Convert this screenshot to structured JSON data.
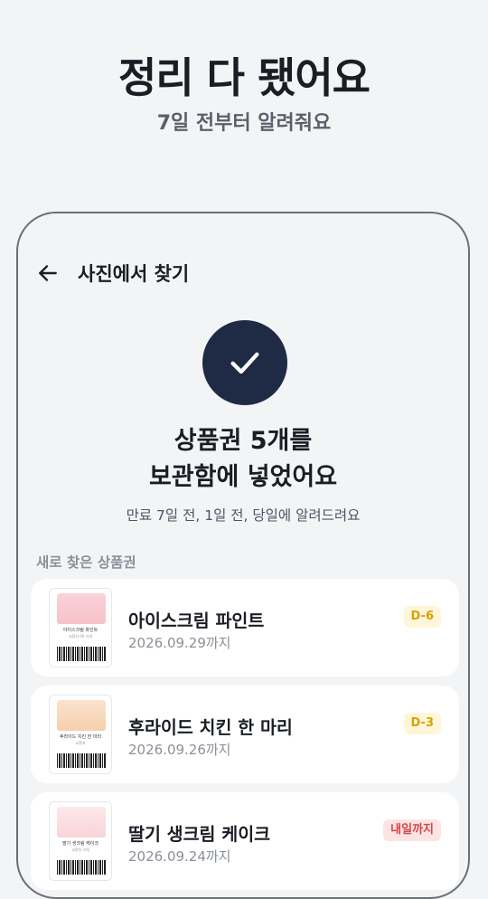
{
  "promo": {
    "title": "정리 다 됐어요",
    "subtitle": "7일 전부터 알려줘요"
  },
  "appbar": {
    "back_icon": "arrow-left-icon",
    "title": "사진에서 찾기"
  },
  "result": {
    "icon": "checkmark-icon",
    "headline_line1": "상품권 5개를",
    "headline_line2": "보관함에 넣었어요",
    "notice": "만료 7일 전, 1일 전, 당일에 알려드려요"
  },
  "section": {
    "label": "새로 찾은 상품권"
  },
  "vouchers": [
    {
      "name": "아이스크림 파인트",
      "expiry": "2026.09.29까지",
      "badge": "D-6",
      "badge_type": "warn",
      "badge_color": "#d9a100",
      "thumb_caption": "아이스크림 파인트",
      "thumb_sub": "교환처 00 가게"
    },
    {
      "name": "후라이드 치킨 한 마리",
      "expiry": "2026.09.26까지",
      "badge": "D-3",
      "badge_type": "warn",
      "badge_color": "#d9a100",
      "thumb_caption": "후라이드 치킨 한 마리",
      "thumb_sub": "교환처"
    },
    {
      "name": "딸기 생크림 케이크",
      "expiry": "2026.09.24까지",
      "badge": "내일까지",
      "badge_type": "urgent",
      "badge_color": "#d94343",
      "thumb_caption": "딸기 생크림 케이크",
      "thumb_sub": "교환처 가게"
    }
  ],
  "colors": {
    "accent_dark": "#1f2a44",
    "background": "#f3f4f6",
    "card": "#ffffff"
  }
}
